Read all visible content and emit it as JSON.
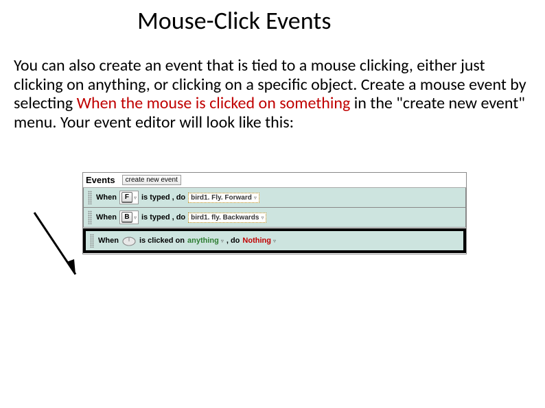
{
  "title": "Mouse-Click Events",
  "body": {
    "p1a": "You can also create an event that is tied to a mouse clicking, either just clicking on anything, or clicking on a specific object. Create a mouse event by selecting ",
    "p1red": "When the mouse is clicked on something",
    "p1b": " in the \"create new event\" menu. Your event editor will look like this:"
  },
  "editor": {
    "eventsLabel": "Events",
    "createBtn": "create new event",
    "rows": [
      {
        "when": "When",
        "key": "F",
        "typed": "is typed , do",
        "action": "bird1. Fly. Forward"
      },
      {
        "when": "When",
        "key": "B",
        "typed": "is typed , do",
        "action": "bird1. fly. Backwards"
      }
    ],
    "mouseRow": {
      "when": "When",
      "clicked": "is clicked on",
      "target": "anything",
      "comma": ", do",
      "nothing": "Nothing"
    }
  }
}
